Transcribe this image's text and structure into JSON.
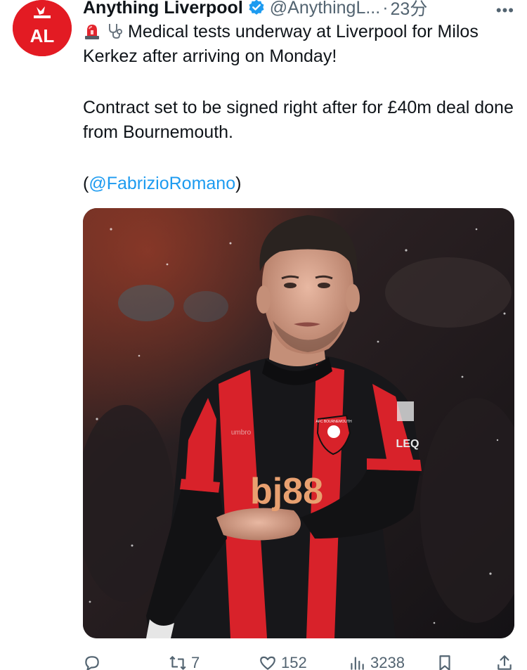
{
  "tweet": {
    "author_name": "Anything Liverpool",
    "author_handle": "@AnythingL...",
    "separator": "·",
    "time": "23分",
    "more_label": "•••",
    "line1": "Medical tests underway at Liverpool for Milos Kerkez after arriving on Monday!",
    "line2": "Contract set to be signed right after for £40m deal done from Bournemouth.",
    "line3_open": "(",
    "mention": "@FabrizioRomano",
    "line3_close": ")",
    "emoji": [
      "siren-emoji",
      "stethoscope-emoji"
    ],
    "avatar_text": "AL"
  },
  "media": {
    "sponsor_text": "bj88",
    "crest_text": "AFC BOURNEMOUTH",
    "kit_maker": "umbro",
    "sleeve_text": "LEQ"
  },
  "actions": {
    "reply_count": "",
    "retweet_count": "7",
    "like_count": "152",
    "views_count": "3238"
  },
  "colors": {
    "accent": "#1d9bf0",
    "secondary_text": "#536471",
    "avatar_red": "#e31b23",
    "kit_red": "#d8222a"
  }
}
